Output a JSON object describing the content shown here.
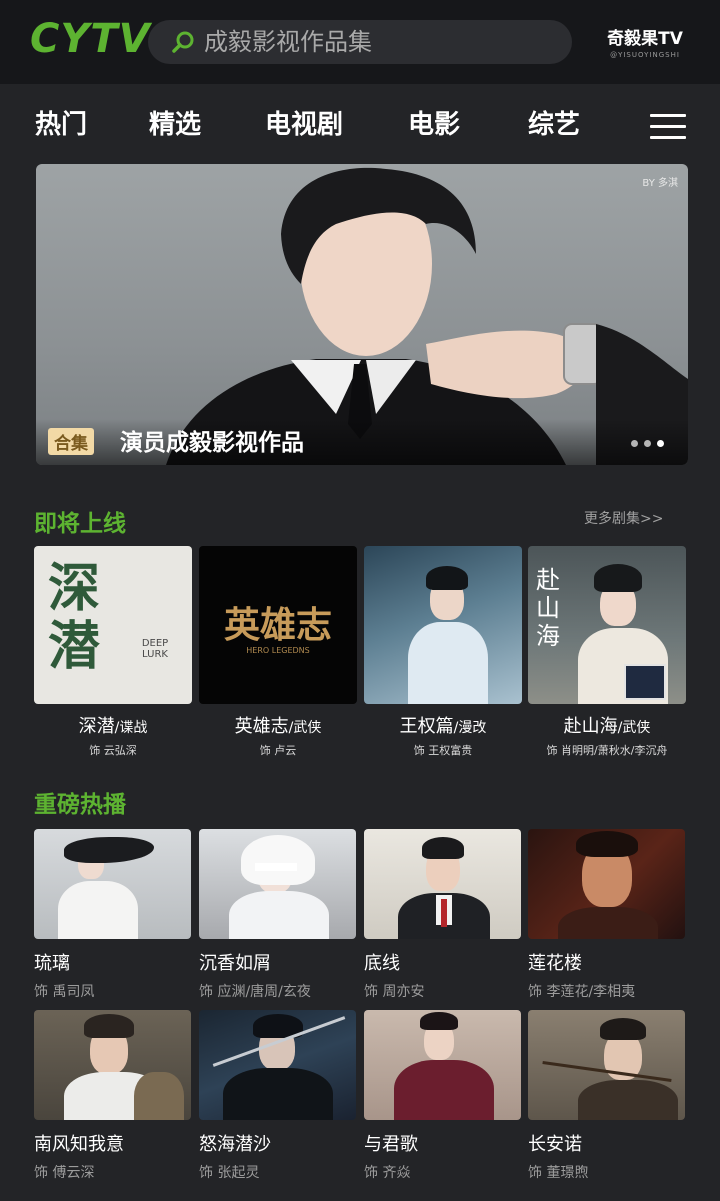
{
  "header": {
    "logo": "CYTV",
    "search_placeholder": "成毅影视作品集",
    "brand": "奇毅果TV",
    "brand_sub": "@YISUOYINGSHI"
  },
  "nav": {
    "tabs": [
      "热门",
      "精选",
      "电视剧",
      "电影",
      "综艺"
    ]
  },
  "banner": {
    "byline": "BY 多淇",
    "tag": "合集",
    "title": "演员成毅影视作品",
    "slides": 3,
    "active_slide": 3
  },
  "upcoming": {
    "heading": "即将上线",
    "more": "更多剧集>>",
    "items": [
      {
        "title": "深潜",
        "genre": "/谍战",
        "role": "饰 云弘深",
        "poster_text": "深潜",
        "poster_sub": "DEEP LURK"
      },
      {
        "title": "英雄志",
        "genre": "/武侠",
        "role": "饰 卢云",
        "poster_text": "英雄志",
        "poster_sub": "HERO LEGEDNS"
      },
      {
        "title": "王权篇",
        "genre": "/漫改",
        "role": "饰 王权富贵"
      },
      {
        "title": "赴山海",
        "genre": "/武侠",
        "role": "饰 肖明明/萧秋水/李沉舟",
        "poster_text": "赴山海"
      }
    ]
  },
  "hot": {
    "heading": "重磅热播",
    "items": [
      {
        "title": "琉璃",
        "role": "饰 禹司凤"
      },
      {
        "title": "沉香如屑",
        "role": "饰 应渊/唐周/玄夜"
      },
      {
        "title": "底线",
        "role": "饰 周亦安"
      },
      {
        "title": "莲花楼",
        "role": "饰 李莲花/李相夷"
      },
      {
        "title": "南风知我意",
        "role": "饰 傅云深"
      },
      {
        "title": "怒海潜沙",
        "role": "饰 张起灵"
      },
      {
        "title": "与君歌",
        "role": "饰 齐焱"
      },
      {
        "title": "长安诺",
        "role": "饰 董璟煦"
      }
    ]
  },
  "colors": {
    "accent": "#5db331",
    "background": "#232427",
    "topbar": "#16171a"
  }
}
